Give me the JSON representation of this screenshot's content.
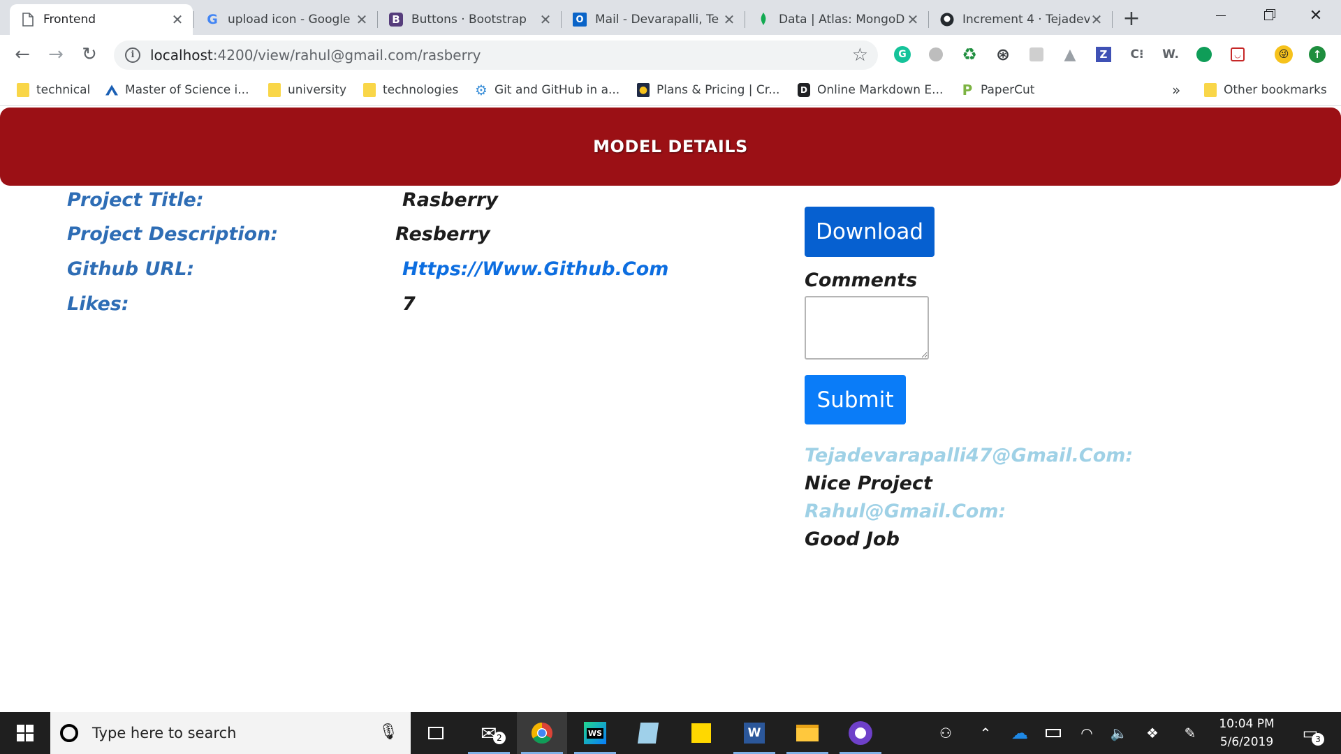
{
  "browser": {
    "tabs": [
      {
        "title": "Frontend",
        "icon": "page-icon",
        "active": true
      },
      {
        "title": "upload icon - Google",
        "icon": "google-icon"
      },
      {
        "title": "Buttons · Bootstrap",
        "icon": "bootstrap-icon"
      },
      {
        "title": "Mail - Devarapalli, Te",
        "icon": "outlook-icon"
      },
      {
        "title": "Data | Atlas: MongoD",
        "icon": "mongodb-leaf-icon"
      },
      {
        "title": "Increment 4 · Tejadev",
        "icon": "github-icon"
      }
    ],
    "new_tab_label": "+",
    "url_host": "localhost",
    "url_rest": ":4200/view/rahul@gmail.com/rasberry",
    "bookmarks": [
      {
        "label": "technical",
        "icon": "folder-icon"
      },
      {
        "label": "Master of Science i...",
        "icon": "university-logo-icon"
      },
      {
        "label": "university",
        "icon": "folder-icon"
      },
      {
        "label": "technologies",
        "icon": "folder-icon"
      },
      {
        "label": "Git and GitHub in a...",
        "icon": "gear-icon"
      },
      {
        "label": "Plans & Pricing | Cr...",
        "icon": "bulb-icon"
      },
      {
        "label": "Online Markdown E...",
        "icon": "markdown-icon"
      },
      {
        "label": "PaperCut",
        "icon": "papercut-icon"
      }
    ],
    "more_bookmarks": "»",
    "other_bookmarks": "Other bookmarks",
    "extensions": [
      "G",
      "W."
    ]
  },
  "page": {
    "header_title": "MODEL DETAILS",
    "details": [
      {
        "label": "Project Title:",
        "value": "Rasberry"
      },
      {
        "label": "Project Description:",
        "value": "Resberry"
      },
      {
        "label": "Github URL:",
        "value": "Https://Www.Github.Com"
      },
      {
        "label": "Likes:",
        "value": "7"
      }
    ],
    "download_label": "Download",
    "comments_label": "Comments",
    "comments_value": "",
    "submit_label": "Submit",
    "comments": [
      {
        "author": "Tejadevarapalli47@Gmail.Com:",
        "text": "Nice Project"
      },
      {
        "author": "Rahul@Gmail.Com:",
        "text": "Good Job"
      }
    ]
  },
  "taskbar": {
    "search_placeholder": "Type here to search",
    "mail_badge": "2",
    "notification_badge": "3",
    "time": "10:04 PM",
    "date": "5/6/2019"
  },
  "colors": {
    "header_bg": "#9b1015",
    "label": "#2e6db5",
    "link": "#0d6ee0",
    "download_btn": "#0660d0",
    "submit_btn": "#0a7cf8",
    "comment_author": "#9fd1e6"
  }
}
